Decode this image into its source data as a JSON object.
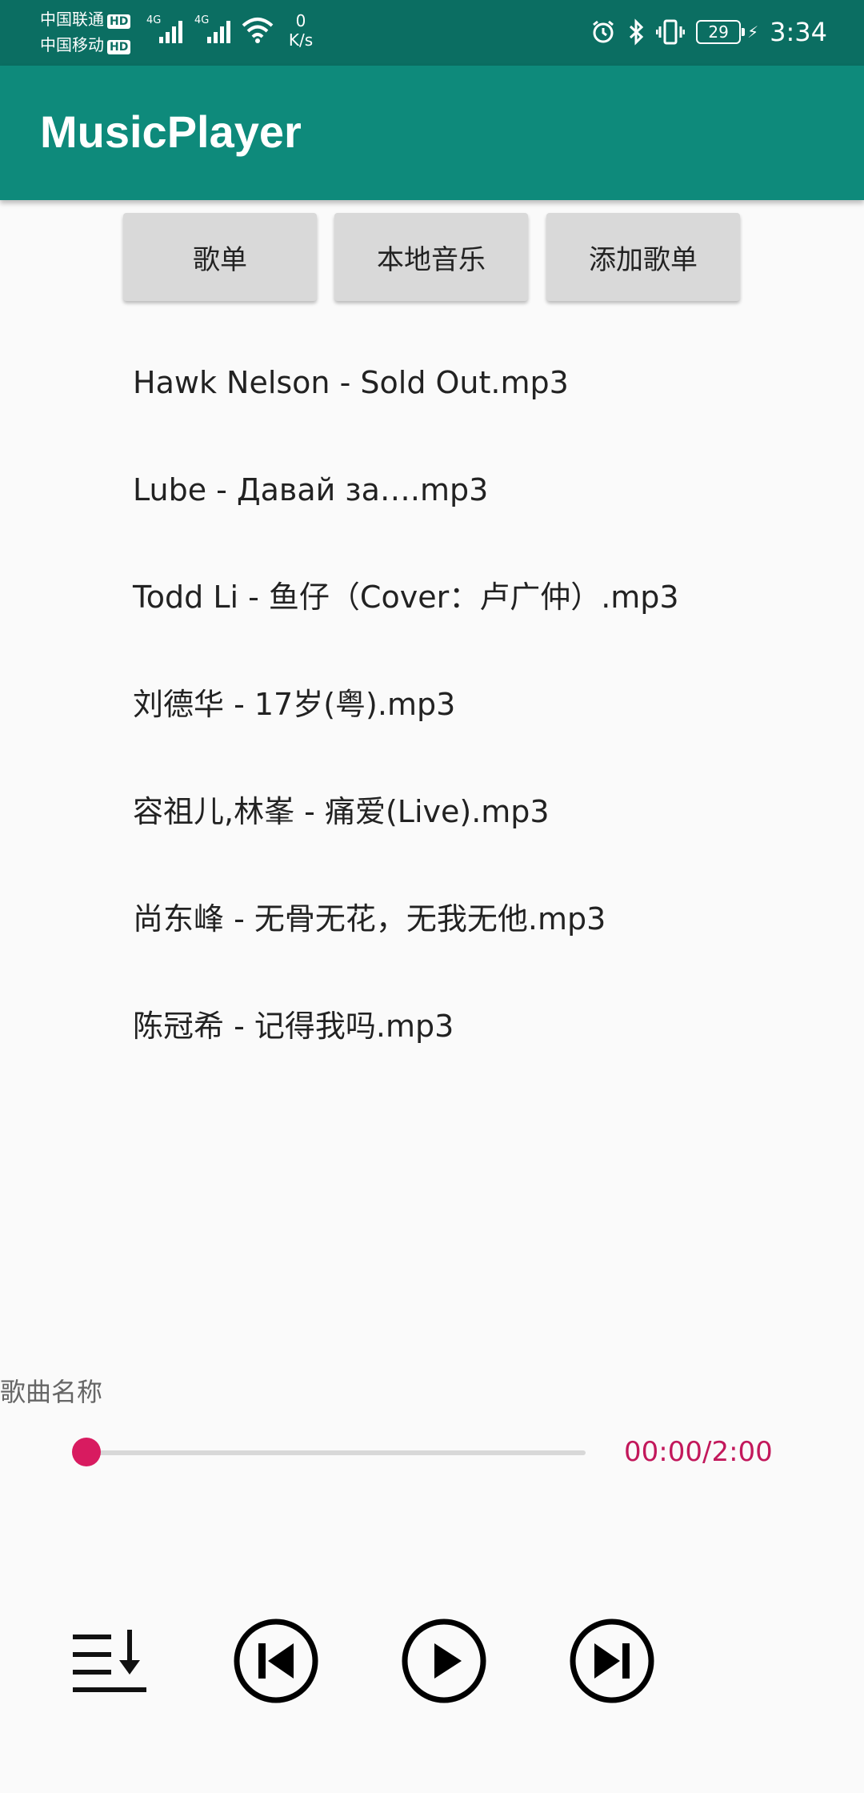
{
  "status_bar": {
    "carrier1": "中国联通",
    "carrier2": "中国移动",
    "hd_label": "HD",
    "net1": "4G",
    "net2": "4G",
    "speed_value": "0",
    "speed_unit": "K/s",
    "battery": "29",
    "time": "3:34"
  },
  "app": {
    "title": "MusicPlayer"
  },
  "tabs": [
    {
      "label": "歌单"
    },
    {
      "label": "本地音乐"
    },
    {
      "label": "添加歌单"
    }
  ],
  "songs": [
    "Hawk Nelson - Sold Out.mp3",
    "Lube - Давай за….mp3",
    "Todd Li - 鱼仔（Cover：卢广仲）.mp3",
    "刘德华 - 17岁(粤).mp3",
    "容祖儿,林峯 - 痛爱(Live).mp3",
    "尚东峰 - 无骨无花，无我无他.mp3",
    "陈冠希 - 记得我吗.mp3"
  ],
  "player": {
    "song_name": "歌曲名称",
    "time_display": "00:00/2:00",
    "progress_fraction": 0.0,
    "accent_color": "#d81b60"
  },
  "controls": [
    {
      "icon": "playlist-order-icon"
    },
    {
      "icon": "previous-icon"
    },
    {
      "icon": "play-icon"
    },
    {
      "icon": "next-icon"
    }
  ]
}
